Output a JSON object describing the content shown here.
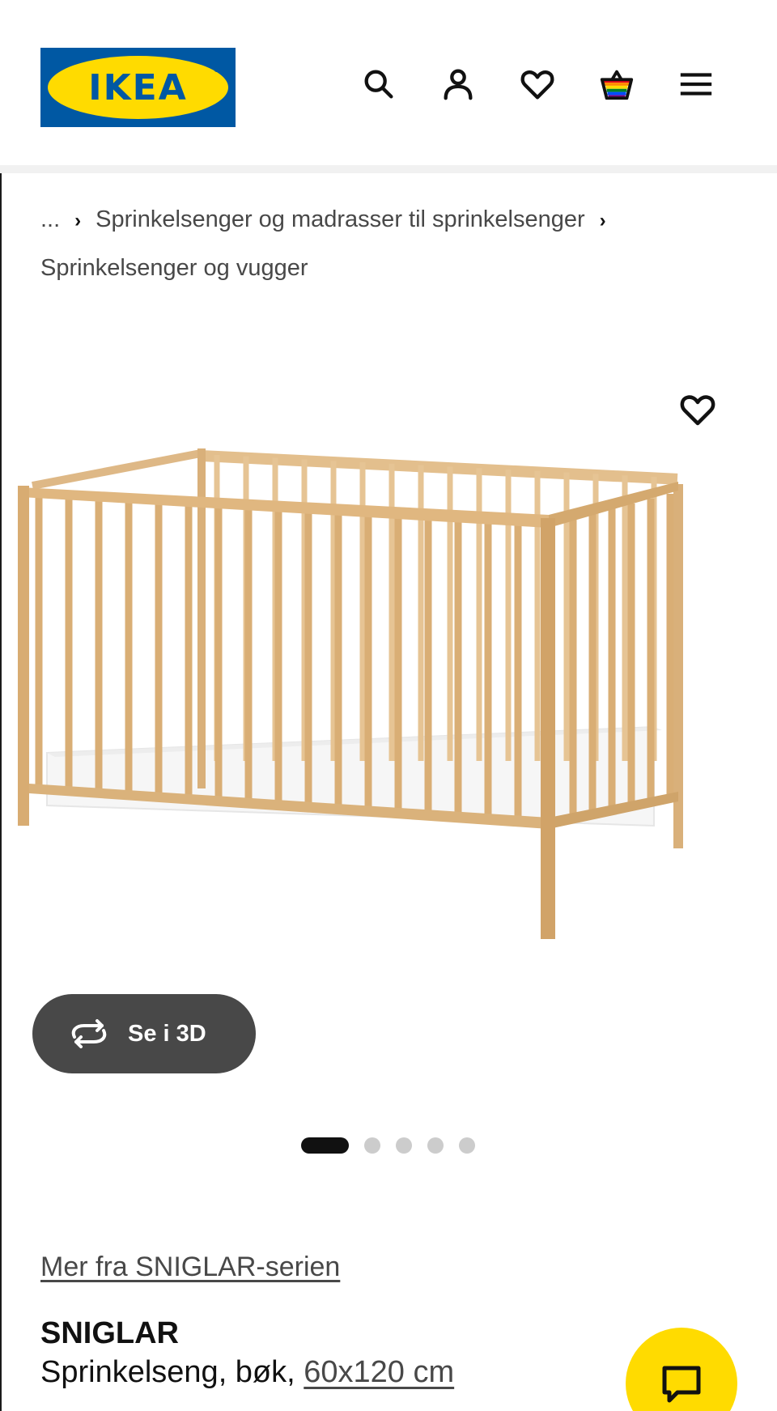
{
  "brand": {
    "logo_text": "IKEA",
    "logo_registered": "®",
    "colors": {
      "blue": "#0058a3",
      "yellow": "#ffdb00",
      "dark_gray": "#484848"
    }
  },
  "header": {
    "icons": [
      "search-icon",
      "user-icon",
      "heart-icon",
      "cart-icon",
      "menu-icon"
    ]
  },
  "breadcrumb": {
    "ellipsis": "...",
    "level1": "Sprinkelsenger og madrasser til sprinkelsenger",
    "level2": "Sprinkelsenger og vugger"
  },
  "gallery": {
    "view_3d_label": "Se i 3D",
    "image_count": 5,
    "active_index": 0
  },
  "product": {
    "series_link": "Mer fra SNIGLAR-serien",
    "name": "SNIGLAR",
    "description_prefix": "Sprinkelseng, bøk, ",
    "size": "60x120 cm"
  },
  "chat": {
    "icon": "chat-icon"
  }
}
